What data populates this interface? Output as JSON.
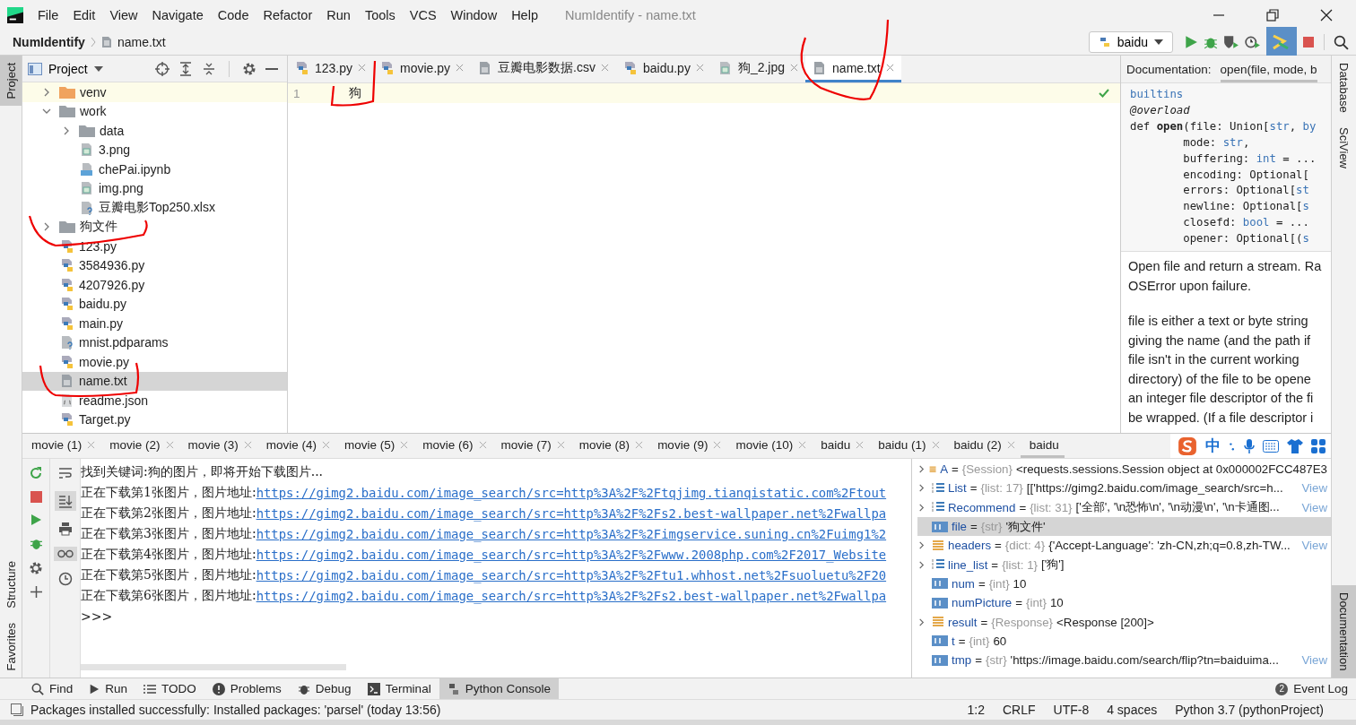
{
  "menu": [
    "File",
    "Edit",
    "View",
    "Navigate",
    "Code",
    "Refactor",
    "Run",
    "Tools",
    "VCS",
    "Window",
    "Help"
  ],
  "window": {
    "title": "NumIdentify - name.txt"
  },
  "breadcrumb": [
    "NumIdentify",
    "name.txt"
  ],
  "run_config": {
    "label": "baidu"
  },
  "left_stripe": [
    {
      "label": "Project",
      "selected": true
    },
    {
      "label": "Structure",
      "selected": false
    },
    {
      "label": "Favorites",
      "selected": false
    }
  ],
  "right_stripe": [
    {
      "label": "Database",
      "selected": false
    },
    {
      "label": "SciView",
      "selected": false
    },
    {
      "label": "Documentation",
      "selected": true
    }
  ],
  "project_panel": {
    "title": "Project"
  },
  "tree": [
    {
      "label": "venv",
      "kind": "folder-excluded",
      "expanded": false,
      "selected": false
    },
    {
      "label": "work",
      "kind": "folder",
      "expanded": true,
      "selected": false,
      "children": [
        {
          "label": "data",
          "kind": "folder",
          "expanded": false,
          "selected": false
        },
        {
          "label": "3.png",
          "kind": "image",
          "selected": false
        },
        {
          "label": "chePai.ipynb",
          "kind": "notebook",
          "selected": false
        },
        {
          "label": "img.png",
          "kind": "image",
          "selected": false
        },
        {
          "label": "豆瓣电影Top250.xlsx",
          "kind": "unknown",
          "selected": false
        }
      ]
    },
    {
      "label": "狗文件",
      "kind": "folder",
      "expanded": false,
      "selected": false
    },
    {
      "label": "123.py",
      "kind": "python",
      "selected": false
    },
    {
      "label": "3584936.py",
      "kind": "python",
      "selected": false
    },
    {
      "label": "4207926.py",
      "kind": "python",
      "selected": false
    },
    {
      "label": "baidu.py",
      "kind": "python",
      "selected": false
    },
    {
      "label": "main.py",
      "kind": "python",
      "selected": false
    },
    {
      "label": "mnist.pdparams",
      "kind": "unknown",
      "selected": false
    },
    {
      "label": "movie.py",
      "kind": "python",
      "selected": false
    },
    {
      "label": "name.txt",
      "kind": "text",
      "selected": true
    },
    {
      "label": "readme.json",
      "kind": "json",
      "selected": false
    },
    {
      "label": "Target.py",
      "kind": "python",
      "selected": false
    }
  ],
  "editor_tabs": [
    {
      "label": "123.py",
      "kind": "python",
      "selected": false
    },
    {
      "label": "movie.py",
      "kind": "python",
      "selected": false
    },
    {
      "label": "豆瓣电影数据.csv",
      "kind": "text",
      "selected": false
    },
    {
      "label": "baidu.py",
      "kind": "python",
      "selected": false
    },
    {
      "label": "狗_2.jpg",
      "kind": "image",
      "selected": false
    },
    {
      "label": "name.txt",
      "kind": "text",
      "selected": true
    }
  ],
  "editor": {
    "lines": [
      {
        "number": "1",
        "text": "狗"
      }
    ]
  },
  "documentation": {
    "label": "Documentation:",
    "tab": "open(file, mode, b",
    "code": [
      [
        {
          "t": "builtins",
          "kind": "type"
        }
      ],
      [
        {
          "t": "@overload",
          "kind": "italic"
        }
      ],
      [
        {
          "t": "def ",
          "kind": "plain"
        },
        {
          "t": "open",
          "kind": "bold"
        },
        {
          "t": "(file: Union[",
          "kind": "plain"
        },
        {
          "t": "str",
          "kind": "type"
        },
        {
          "t": ", ",
          "kind": "plain"
        },
        {
          "t": "by",
          "kind": "type"
        }
      ],
      [
        {
          "t": "        mode: ",
          "kind": "plain"
        },
        {
          "t": "str",
          "kind": "type"
        },
        {
          "t": ",",
          "kind": "plain"
        }
      ],
      [
        {
          "t": "        buffering: ",
          "kind": "plain"
        },
        {
          "t": "int",
          "kind": "type"
        },
        {
          "t": " = ...",
          "kind": "plain"
        }
      ],
      [
        {
          "t": "        encoding: Optional[",
          "kind": "plain"
        }
      ],
      [
        {
          "t": "        errors: Optional[",
          "kind": "plain"
        },
        {
          "t": "st",
          "kind": "type"
        }
      ],
      [
        {
          "t": "        newline: Optional[",
          "kind": "plain"
        },
        {
          "t": "s",
          "kind": "type"
        }
      ],
      [
        {
          "t": "        closefd: ",
          "kind": "plain"
        },
        {
          "t": "bool",
          "kind": "type"
        },
        {
          "t": " = ...",
          "kind": "plain"
        }
      ],
      [
        {
          "t": "        opener: Optional[(",
          "kind": "plain"
        },
        {
          "t": "s",
          "kind": "type"
        }
      ]
    ],
    "paragraphs": [
      [
        "Open file and return a stream. Ra",
        "OSError upon failure."
      ],
      [
        "file is either a text or byte string",
        "giving the name (and the path if",
        "file isn't in the current working",
        "directory) of the file to be opene",
        "an integer file descriptor of the fi",
        "be wrapped. (If a file descriptor i"
      ]
    ]
  },
  "console_tabs": [
    {
      "label": "movie (1)",
      "selected": false
    },
    {
      "label": "movie (2)",
      "selected": false
    },
    {
      "label": "movie (3)",
      "selected": false
    },
    {
      "label": "movie (4)",
      "selected": false
    },
    {
      "label": "movie (5)",
      "selected": false
    },
    {
      "label": "movie (6)",
      "selected": false
    },
    {
      "label": "movie (7)",
      "selected": false
    },
    {
      "label": "movie (8)",
      "selected": false
    },
    {
      "label": "movie (9)",
      "selected": false
    },
    {
      "label": "movie (10)",
      "selected": false
    },
    {
      "label": "baidu",
      "selected": false
    },
    {
      "label": "baidu (1)",
      "selected": false
    },
    {
      "label": "baidu (2)",
      "selected": false
    },
    {
      "label": "baidu",
      "selected": true
    }
  ],
  "console_output": [
    {
      "text": "找到关键词:狗的图片，即将开始下载图片..."
    },
    {
      "text": "正在下载第1张图片，图片地址:",
      "link": "https://gimg2.baidu.com/image_search/src=http%3A%2F%2Ftqjimg.tianqistatic.com%2Ftout"
    },
    {
      "text": "正在下载第2张图片，图片地址:",
      "link": "https://gimg2.baidu.com/image_search/src=http%3A%2F%2Fs2.best-wallpaper.net%2Fwallpa"
    },
    {
      "text": "正在下载第3张图片，图片地址:",
      "link": "https://gimg2.baidu.com/image_search/src=http%3A%2F%2Fimgservice.suning.cn%2Fuimg1%2"
    },
    {
      "text": "正在下载第4张图片，图片地址:",
      "link": "https://gimg2.baidu.com/image_search/src=http%3A%2F%2Fwww.2008php.com%2F2017_Website"
    },
    {
      "text": "正在下载第5张图片，图片地址:",
      "link": "https://gimg2.baidu.com/image_search/src=http%3A%2F%2Ftu1.whhost.net%2Fsuoluetu%2F20"
    },
    {
      "text": "正在下载第6张图片，图片地址:",
      "link": "https://gimg2.baidu.com/image_search/src=http%3A%2F%2Fs2.best-wallpaper.net%2Fwallpa"
    },
    {
      "text": ">>>"
    }
  ],
  "variables": [
    {
      "name": "A",
      "eq": "=",
      "type": "{Session}",
      "value": "<requests.sessions.Session object at 0x000002FCC487E3",
      "kind": "object",
      "expandable": true,
      "selected": false
    },
    {
      "name": "List",
      "eq": "=",
      "type": "{list: 17}",
      "value": "[['https://gimg2.baidu.com/image_search/src=h...",
      "view": "View",
      "kind": "list",
      "expandable": true,
      "selected": false
    },
    {
      "name": "Recommend",
      "eq": "=",
      "type": "{list: 31}",
      "value": "['全部', '\\n恐怖\\n', '\\n动漫\\n', '\\n卡通图...",
      "view": "View",
      "kind": "list",
      "expandable": true,
      "selected": false
    },
    {
      "name": "file",
      "eq": "=",
      "type": "{str}",
      "value": "'狗文件'",
      "kind": "scalar",
      "expandable": false,
      "selected": true
    },
    {
      "name": "headers",
      "eq": "=",
      "type": "{dict: 4}",
      "value": "{'Accept-Language': 'zh-CN,zh;q=0.8,zh-TW...",
      "view": "View",
      "kind": "object",
      "expandable": true,
      "selected": false
    },
    {
      "name": "line_list",
      "eq": "=",
      "type": "{list: 1}",
      "value": "['狗']",
      "kind": "list",
      "expandable": true,
      "selected": false
    },
    {
      "name": "num",
      "eq": "=",
      "type": "{int}",
      "value": "10",
      "kind": "scalar",
      "expandable": false,
      "selected": false
    },
    {
      "name": "numPicture",
      "eq": "=",
      "type": "{int}",
      "value": "10",
      "kind": "scalar",
      "expandable": false,
      "selected": false
    },
    {
      "name": "result",
      "eq": "=",
      "type": "{Response}",
      "value": "<Response [200]>",
      "kind": "object",
      "expandable": true,
      "selected": false
    },
    {
      "name": "t",
      "eq": "=",
      "type": "{int}",
      "value": "60",
      "kind": "scalar",
      "expandable": false,
      "selected": false
    },
    {
      "name": "tmp",
      "eq": "=",
      "type": "{str}",
      "value": "'https://image.baidu.com/search/flip?tn=baiduima...",
      "view": "View",
      "kind": "scalar",
      "expandable": false,
      "selected": false
    }
  ],
  "tool_windows": [
    {
      "label": "Find",
      "kind": "search",
      "selected": false
    },
    {
      "label": "Run",
      "kind": "run",
      "selected": false
    },
    {
      "label": "TODO",
      "kind": "todo",
      "selected": false
    },
    {
      "label": "Problems",
      "kind": "problems",
      "selected": false
    },
    {
      "label": "Debug",
      "kind": "debug",
      "selected": false
    },
    {
      "label": "Terminal",
      "kind": "terminal",
      "selected": false
    },
    {
      "label": "Python Console",
      "kind": "python",
      "selected": true
    }
  ],
  "event_log": {
    "label": "Event Log",
    "count": "2"
  },
  "ime": {
    "label": "中"
  },
  "console_toggles": {
    "scroll_to_end": true,
    "show_variables": true
  },
  "status_bar": {
    "message": "Packages installed successfully: Installed packages: 'parsel' (today 13:56)",
    "items": [
      "1:2",
      "CRLF",
      "UTF-8",
      "4 spaces",
      "Python 3.7 (pythonProject)"
    ]
  }
}
